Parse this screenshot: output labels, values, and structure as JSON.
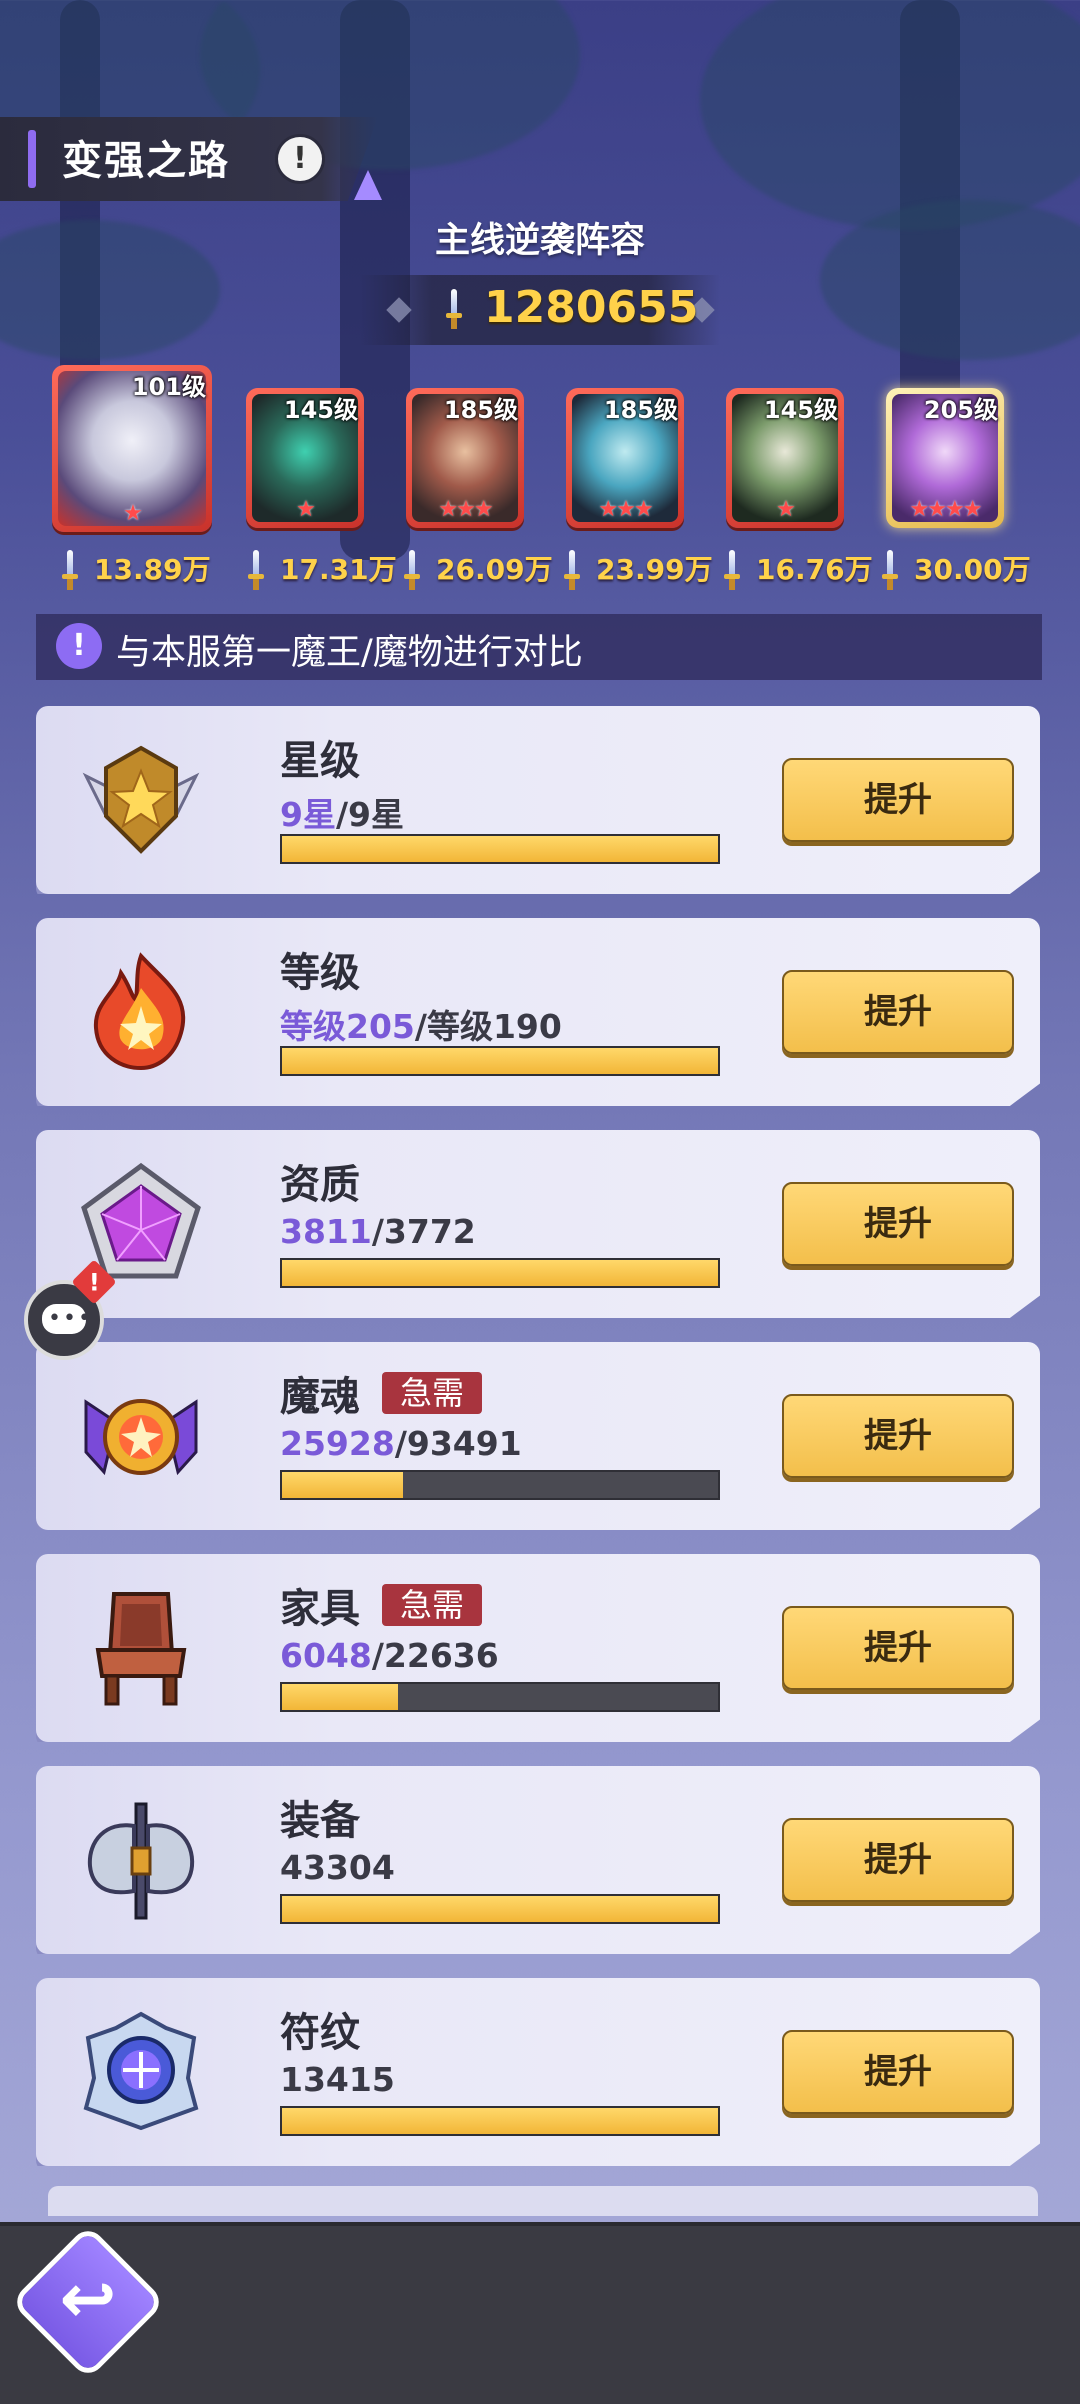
{
  "header": {
    "title": "变强之路",
    "info_symbol": "!",
    "lineup_label": "主线逆袭阵容",
    "total_power": "1280655"
  },
  "heroes": [
    {
      "level": "101级",
      "stars": "★",
      "power": "13.89万"
    },
    {
      "level": "145级",
      "stars": "★",
      "power": "17.31万"
    },
    {
      "level": "185级",
      "stars": "★★★",
      "power": "26.09万"
    },
    {
      "level": "185级",
      "stars": "★★★",
      "power": "23.99万"
    },
    {
      "level": "145级",
      "stars": "★",
      "power": "16.76万"
    },
    {
      "level": "205级",
      "stars": "★★★★",
      "power": "30.00万"
    }
  ],
  "compare": {
    "icon_symbol": "!",
    "text": "与本服第一魔王/魔物进行对比"
  },
  "stats": [
    {
      "name": "星级",
      "current": "9星",
      "separator": "/",
      "target": "9星",
      "progress": 1.0,
      "urgent": "",
      "button": "提升",
      "icon": "star-rank-emblem-icon"
    },
    {
      "name": "等级",
      "current": "等级205",
      "separator": "/",
      "target": "等级190",
      "progress": 1.0,
      "urgent": "",
      "button": "提升",
      "icon": "flame-level-icon"
    },
    {
      "name": "资质",
      "current": "3811",
      "separator": "/",
      "target": "3772",
      "progress": 1.0,
      "urgent": "",
      "button": "提升",
      "icon": "pentagon-gem-icon"
    },
    {
      "name": "魔魂",
      "current": "25928",
      "separator": "/",
      "target": "93491",
      "progress": 0.277,
      "urgent": "急需",
      "button": "提升",
      "icon": "demon-soul-icon"
    },
    {
      "name": "家具",
      "current": "6048",
      "separator": "/",
      "target": "22636",
      "progress": 0.267,
      "urgent": "急需",
      "button": "提升",
      "icon": "throne-furniture-icon"
    },
    {
      "name": "装备",
      "current": "",
      "separator": "",
      "target": "43304",
      "progress": 1.0,
      "urgent": "",
      "button": "提升",
      "icon": "axe-equipment-icon"
    },
    {
      "name": "符纹",
      "current": "",
      "separator": "",
      "target": "13415",
      "progress": 1.0,
      "urgent": "",
      "button": "提升",
      "icon": "rune-emblem-icon"
    }
  ],
  "chat_alert": "!",
  "back_symbol": "↩",
  "colors": {
    "accent_purple": "#8f6cf0",
    "gold": "#ffd24a",
    "urgent_red": "#a8343e",
    "progress_fill": "#f2b637"
  }
}
